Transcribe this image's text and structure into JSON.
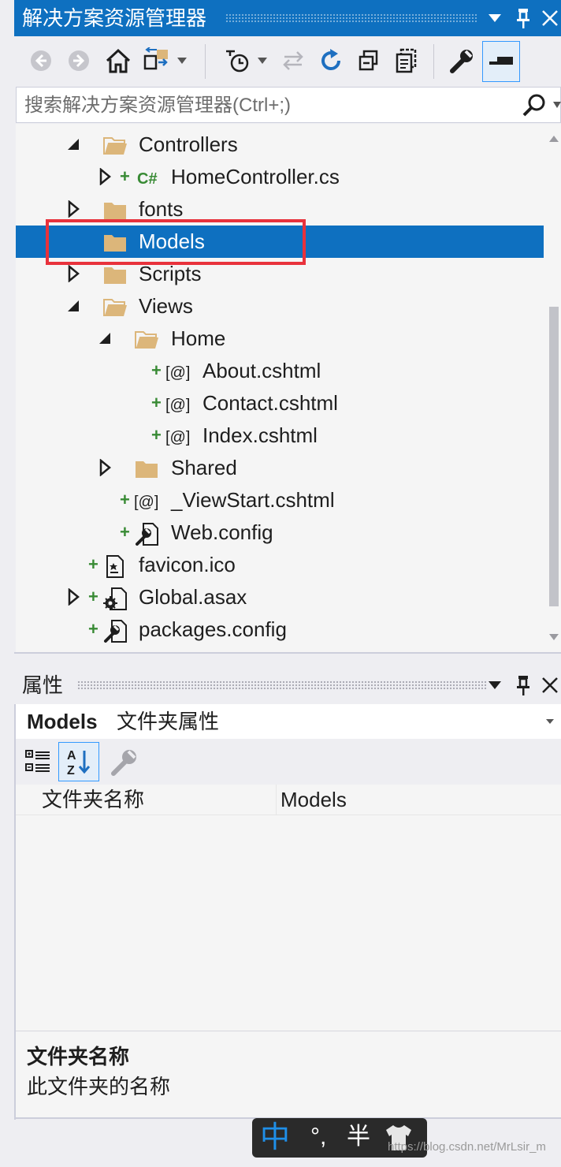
{
  "solution_explorer": {
    "title": "解决方案资源管理器",
    "search_placeholder": "搜索解决方案资源管理器(Ctrl+;)",
    "tree": [
      {
        "label": "Controllers",
        "kind": "folder-open",
        "expander": "expanded",
        "plus": false
      },
      {
        "label": "HomeController.cs",
        "kind": "csharp",
        "expander": "collapsed",
        "plus": true
      },
      {
        "label": "fonts",
        "kind": "folder",
        "expander": "collapsed",
        "plus": false
      },
      {
        "label": "Models",
        "kind": "folder",
        "expander": "none",
        "plus": false,
        "selected": true
      },
      {
        "label": "Scripts",
        "kind": "folder",
        "expander": "collapsed",
        "plus": false
      },
      {
        "label": "Views",
        "kind": "folder-open",
        "expander": "expanded",
        "plus": false
      },
      {
        "label": "Home",
        "kind": "folder-open",
        "expander": "expanded",
        "plus": false
      },
      {
        "label": "About.cshtml",
        "kind": "razor",
        "expander": "none",
        "plus": true
      },
      {
        "label": "Contact.cshtml",
        "kind": "razor",
        "expander": "none",
        "plus": true
      },
      {
        "label": "Index.cshtml",
        "kind": "razor",
        "expander": "none",
        "plus": true
      },
      {
        "label": "Shared",
        "kind": "folder",
        "expander": "collapsed",
        "plus": false
      },
      {
        "label": "_ViewStart.cshtml",
        "kind": "razor",
        "expander": "none",
        "plus": true
      },
      {
        "label": "Web.config",
        "kind": "config",
        "expander": "none",
        "plus": true
      },
      {
        "label": "favicon.ico",
        "kind": "image-file",
        "expander": "none",
        "plus": true
      },
      {
        "label": "Global.asax",
        "kind": "asax",
        "expander": "collapsed",
        "plus": true
      },
      {
        "label": "packages.config",
        "kind": "config",
        "expander": "none",
        "plus": true
      }
    ],
    "razor_glyph": "[@]",
    "csharp_glyph": "C#"
  },
  "properties": {
    "title": "属性",
    "object_name": "Models",
    "object_type": "文件夹属性",
    "rows": [
      {
        "key": "文件夹名称",
        "value": "Models"
      }
    ],
    "description_title": "文件夹名称",
    "description_text": "此文件夹的名称"
  },
  "ime": {
    "mode": "中",
    "punct": "°,",
    "width": "半"
  },
  "watermark": "https://blog.csdn.net/MrLsir_m",
  "colors": {
    "accent": "#0e70c0",
    "highlight": "#e8323c",
    "folder": "#dcb67a",
    "add_plus": "#388a34"
  }
}
